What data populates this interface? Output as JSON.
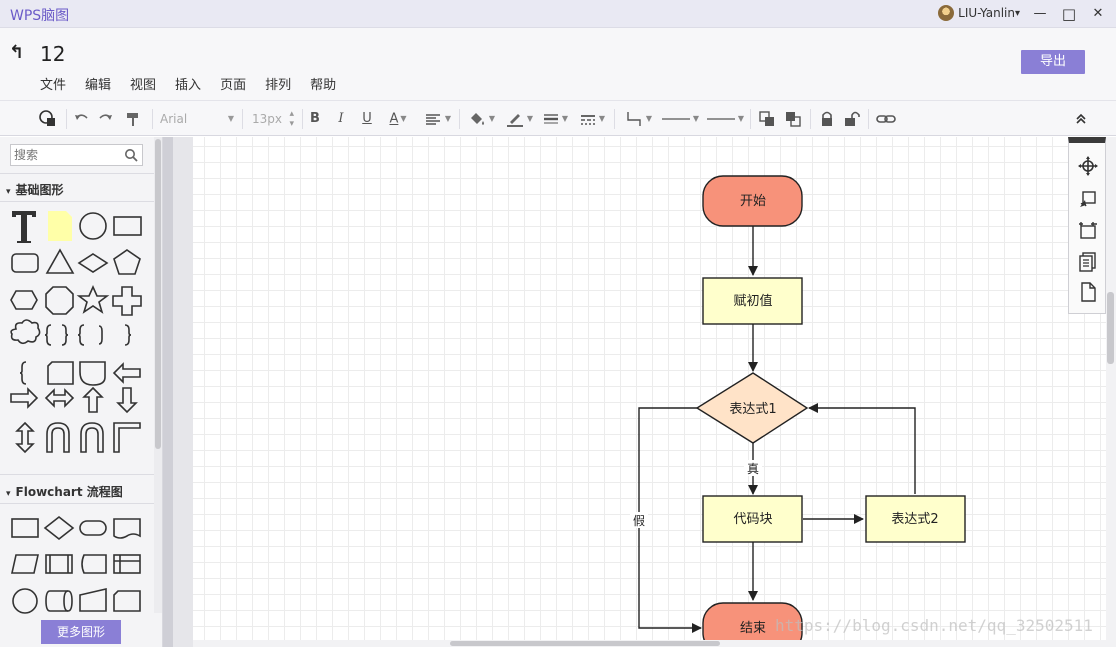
{
  "app": {
    "title": "WPS脑图",
    "user_name": "LIU-Yanlin",
    "user_caret": "▾",
    "minimize_glyph": "—",
    "maximize_glyph": "□",
    "close_glyph": "✕"
  },
  "header": {
    "back_glyph": "↰",
    "doc_title": "12",
    "menu": [
      "文件",
      "编辑",
      "视图",
      "插入",
      "页面",
      "排列",
      "帮助"
    ],
    "export_label": "导出"
  },
  "toolbar": {
    "font_family": "Arial",
    "font_size": "13px",
    "bold": "B",
    "italic": "I",
    "underline": "U",
    "font_color": "A",
    "collapse_glyph": "⌃"
  },
  "sidebar": {
    "search_placeholder": "搜索",
    "sections": [
      "基础图形",
      "Flowchart 流程图"
    ],
    "collapse_glyph": "▾",
    "more_shapes_label": "更多图形"
  },
  "diagram": {
    "nodes": {
      "start": "开始",
      "init": "赋初值",
      "cond1": "表达式1",
      "code": "代码块",
      "cond2": "表达式2",
      "end": "结束"
    },
    "edges": {
      "true_label": "真",
      "false_label": "假"
    },
    "colors": {
      "terminal": "#f7927a",
      "process": "#ffffcc",
      "decision": "#ffe3c8",
      "stroke": "#222222",
      "accent": "#8a7fd6"
    }
  },
  "watermark": "https://blog.csdn.net/qq_32502511"
}
